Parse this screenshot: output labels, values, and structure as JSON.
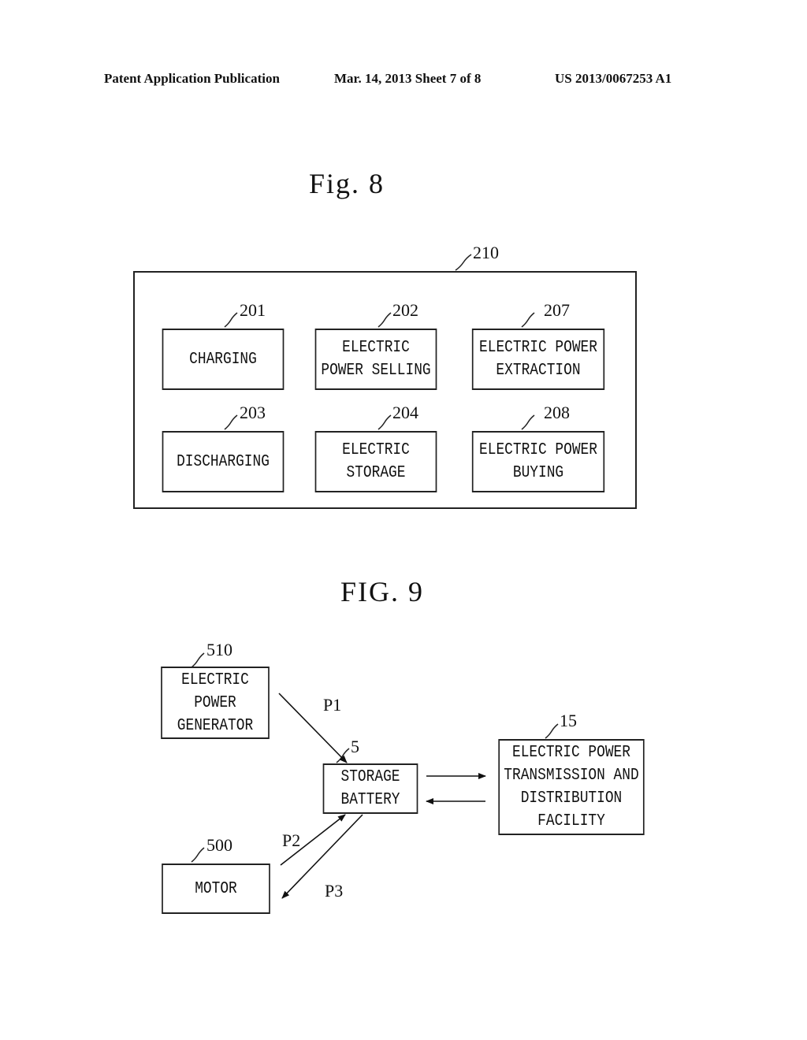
{
  "header": {
    "left": "Patent Application Publication",
    "center": "Mar. 14, 2013  Sheet 7 of 8",
    "right": "US 2013/0067253 A1"
  },
  "fig8": {
    "title": "Fig. 8",
    "container_ref": "210",
    "blocks": [
      {
        "ref": "201",
        "label": "CHARGING"
      },
      {
        "ref": "202",
        "label": "ELECTRIC\nPOWER SELLING"
      },
      {
        "ref": "207",
        "label": "ELECTRIC POWER\nEXTRACTION"
      },
      {
        "ref": "203",
        "label": "DISCHARGING"
      },
      {
        "ref": "204",
        "label": "ELECTRIC\nSTORAGE"
      },
      {
        "ref": "208",
        "label": "ELECTRIC POWER\nBUYING"
      }
    ]
  },
  "fig9": {
    "title": "FIG. 9",
    "nodes": {
      "generator": {
        "ref": "510",
        "label": "ELECTRIC\nPOWER\nGENERATOR"
      },
      "battery": {
        "ref": "5",
        "label": "STORAGE\nBATTERY"
      },
      "facility": {
        "ref": "15",
        "label": "ELECTRIC POWER\nTRANSMISSION AND\nDISTRIBUTION\nFACILITY"
      },
      "motor": {
        "ref": "500",
        "label": "MOTOR"
      }
    },
    "edges": [
      {
        "from": "generator",
        "to": "battery",
        "label": "P1"
      },
      {
        "from": "motor",
        "to": "battery",
        "label": "P2"
      },
      {
        "from": "battery",
        "to": "motor",
        "label": "P3"
      },
      {
        "from": "battery",
        "to": "facility",
        "label": ""
      },
      {
        "from": "facility",
        "to": "battery",
        "label": ""
      }
    ]
  }
}
